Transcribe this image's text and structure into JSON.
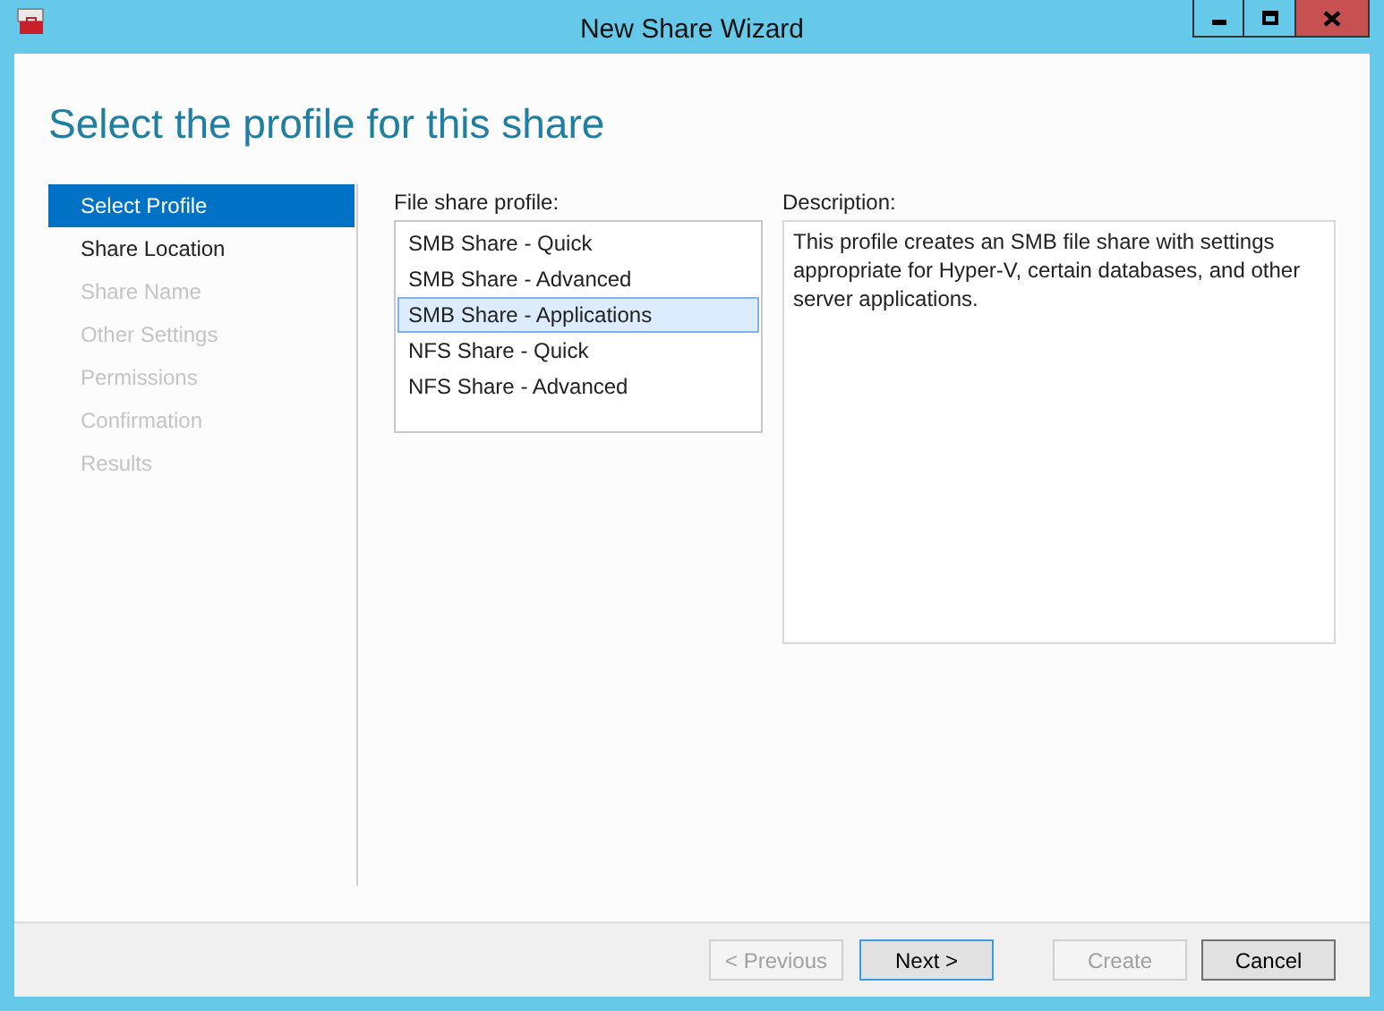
{
  "window": {
    "title": "New Share Wizard"
  },
  "heading": "Select the profile for this share",
  "steps": [
    {
      "label": "Select Profile",
      "selected": true,
      "disabled": false
    },
    {
      "label": "Share Location",
      "selected": false,
      "disabled": false
    },
    {
      "label": "Share Name",
      "selected": false,
      "disabled": true
    },
    {
      "label": "Other Settings",
      "selected": false,
      "disabled": true
    },
    {
      "label": "Permissions",
      "selected": false,
      "disabled": true
    },
    {
      "label": "Confirmation",
      "selected": false,
      "disabled": true
    },
    {
      "label": "Results",
      "selected": false,
      "disabled": true
    }
  ],
  "profiles": {
    "label": "File share profile:",
    "items": [
      {
        "label": "SMB Share - Quick",
        "selected": false
      },
      {
        "label": "SMB Share - Advanced",
        "selected": false
      },
      {
        "label": "SMB Share - Applications",
        "selected": true
      },
      {
        "label": "NFS Share - Quick",
        "selected": false
      },
      {
        "label": "NFS Share - Advanced",
        "selected": false
      }
    ]
  },
  "description": {
    "label": "Description:",
    "text": "This profile creates an SMB file share with settings appropriate for Hyper-V, certain databases, and other server applications."
  },
  "buttons": [
    {
      "label": "< Previous",
      "disabled": true,
      "default": false
    },
    {
      "label": "Next >",
      "disabled": false,
      "default": true
    },
    {
      "label": "Create",
      "disabled": true,
      "default": false
    },
    {
      "label": "Cancel",
      "disabled": false,
      "default": false
    }
  ]
}
